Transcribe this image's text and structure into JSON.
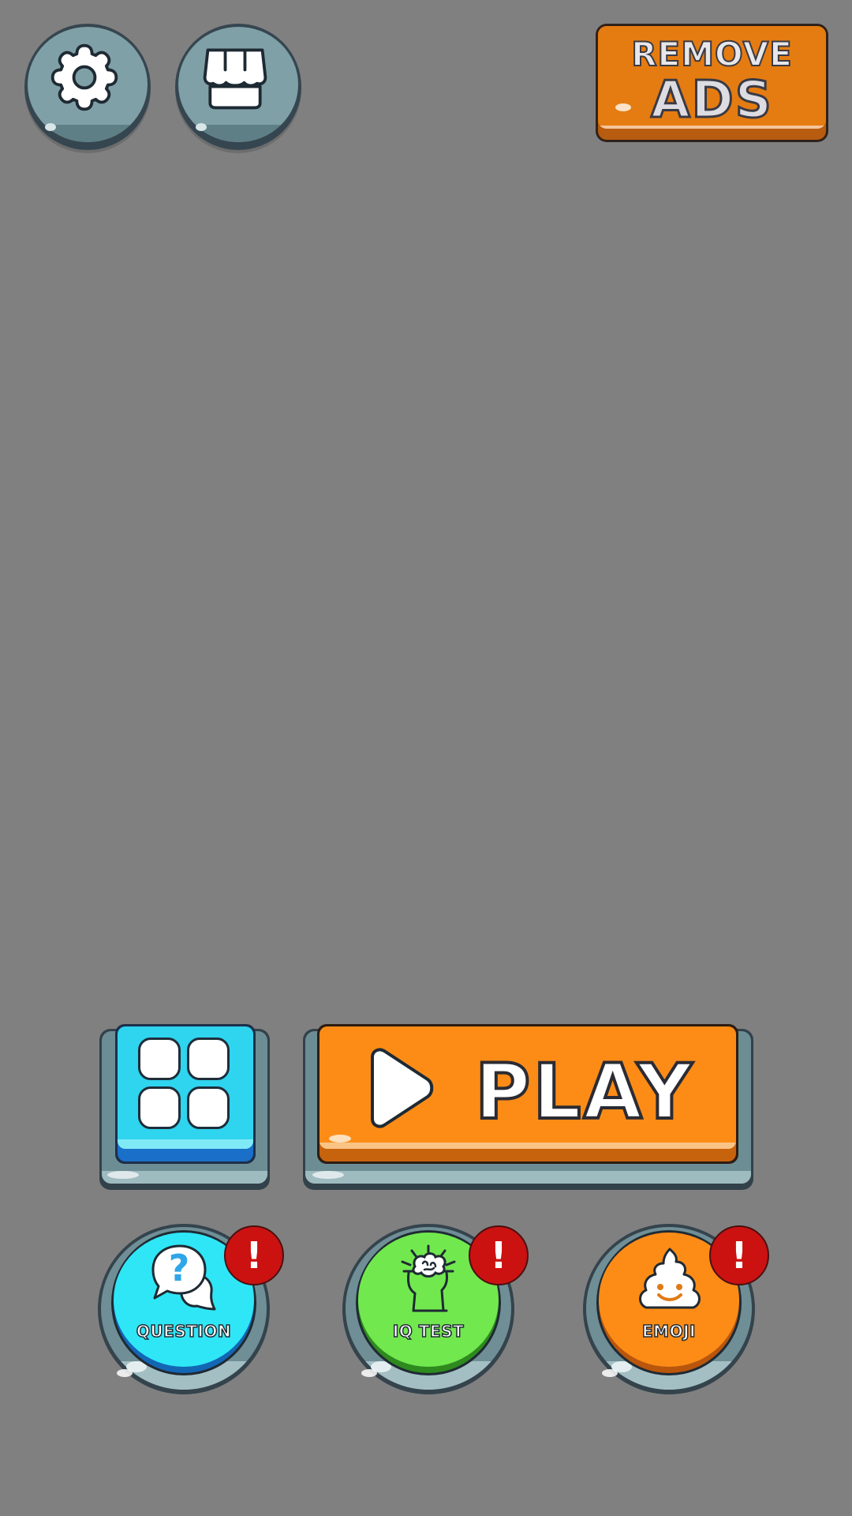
{
  "top_bar": {
    "settings_icon": "gear-icon",
    "shop_icon": "shop-awning-icon",
    "remove_ads": {
      "line1": "REMOVE",
      "line2": "ADS"
    }
  },
  "main_actions": {
    "levels_icon": "grid-icon",
    "play": {
      "icon": "play-triangle-icon",
      "label": "PLAY"
    }
  },
  "modes": [
    {
      "label": "QUESTION",
      "icon": "question-bubble-icon",
      "badge": "!"
    },
    {
      "label": "IQ TEST",
      "icon": "brain-head-icon",
      "badge": "!"
    },
    {
      "label": "EMOJI",
      "icon": "poop-emoji-icon",
      "badge": "!"
    }
  ],
  "colors": {
    "background": "#808080",
    "orange": "#fd8c17",
    "cyan": "#2fe6f6",
    "green": "#72e84f",
    "badge_red": "#cc1111",
    "stone": "#7fa0a6"
  }
}
